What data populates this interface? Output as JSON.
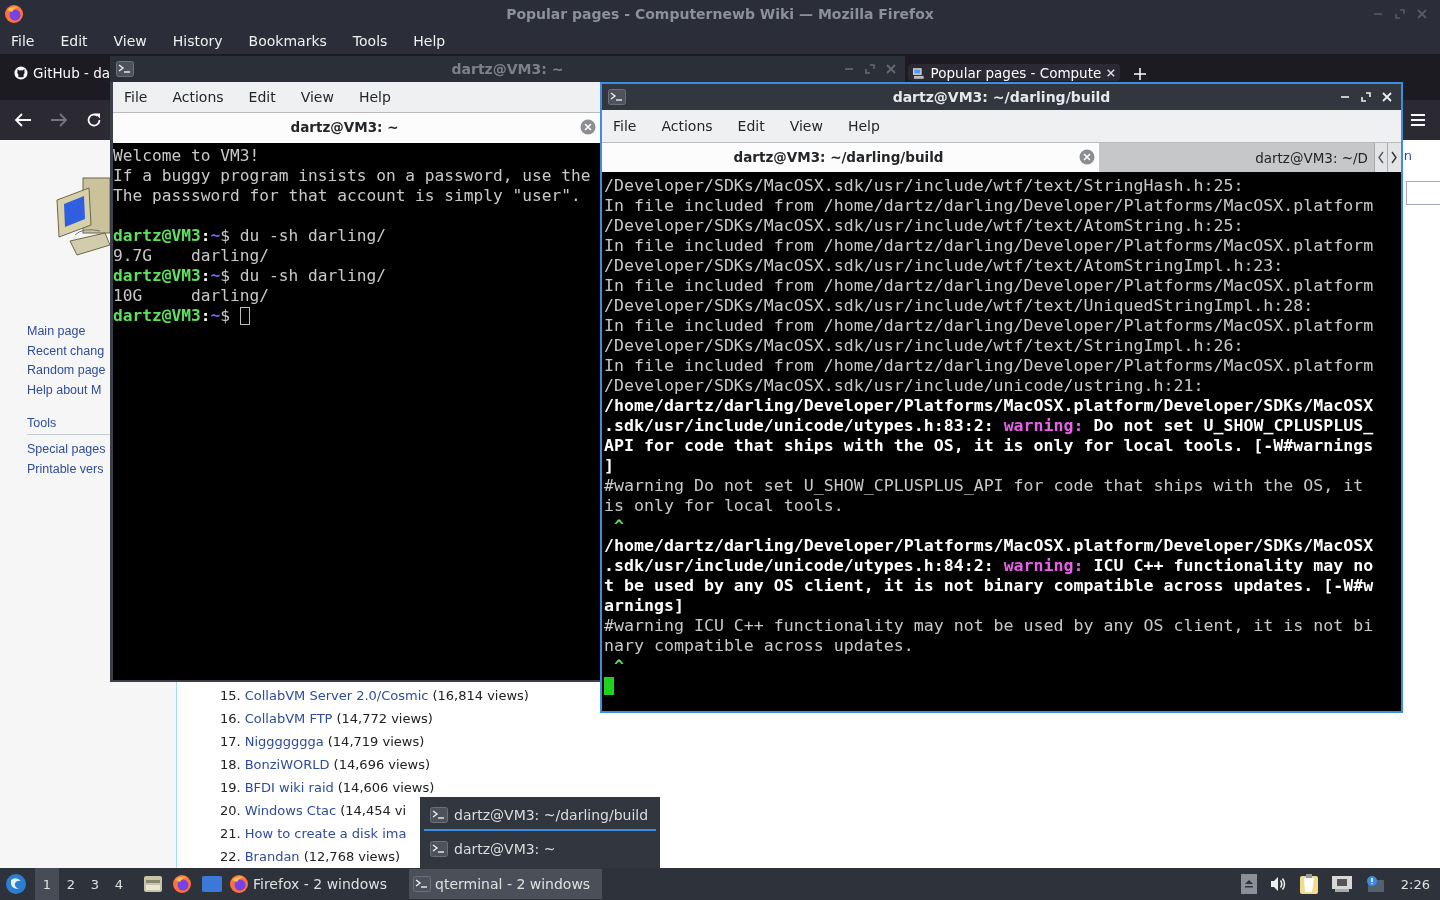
{
  "firefox": {
    "title": "Popular pages - Computernewb Wiki — Mozilla Firefox",
    "menu": [
      "File",
      "Edit",
      "View",
      "History",
      "Bookmarks",
      "Tools",
      "Help"
    ],
    "tabs": [
      {
        "label": "GitHub - da",
        "selected": false
      },
      {
        "label": "Popular pages - Compute",
        "selected": true
      }
    ],
    "forward_enabled": false,
    "wiki": {
      "sidebar_links": [
        "Main page",
        "Recent chang",
        "Random page",
        "Help about M"
      ],
      "tools_heading": "Tools",
      "tools_links": [
        "Special pages",
        "Printable vers"
      ],
      "top_link": "n",
      "list": [
        {
          "number": "15.",
          "title": "CollabVM Server 2.0/Cosmic",
          "views": "(16,814 views)"
        },
        {
          "number": "16.",
          "title": "CollabVM FTP",
          "views": "(14,772 views)"
        },
        {
          "number": "17.",
          "title": "Niggggggga",
          "views": "(14,719 views)"
        },
        {
          "number": "18.",
          "title": "BonziWORLD",
          "views": "(14,696 views)"
        },
        {
          "number": "19.",
          "title": "BFDI wiki raid",
          "views": "(14,606 views)"
        },
        {
          "number": "20.",
          "title": "Windows Ctac",
          "views": "(14,454 vi"
        },
        {
          "number": "21.",
          "title": "How to create a disk ima"
        },
        {
          "number": "22.",
          "title": "Brandan",
          "views": "(12,768 views)"
        }
      ]
    }
  },
  "terminals": [
    {
      "title": "dartz@VM3: ~",
      "focused": false,
      "menu": [
        "File",
        "Actions",
        "Edit",
        "View",
        "Help"
      ],
      "tabs": [
        {
          "label": "dartz@VM3: ~",
          "selected": true
        }
      ],
      "lines": [
        {
          "kind": "text",
          "segments": [
            {
              "kind": "plain",
              "text": "Welcome to VM3!"
            }
          ]
        },
        {
          "kind": "text",
          "segments": [
            {
              "kind": "plain",
              "text": "If a buggy program insists on a password, use the"
            }
          ]
        },
        {
          "kind": "text",
          "segments": [
            {
              "kind": "plain",
              "text": "The passsword for that account is simply \"user\"."
            }
          ]
        },
        {
          "kind": "blank"
        },
        {
          "kind": "text",
          "segments": [
            {
              "kind": "user",
              "text": "dartz@VM3"
            },
            {
              "kind": "bold",
              "text": ":"
            },
            {
              "kind": "path",
              "text": "~"
            },
            {
              "kind": "plain",
              "text": "$ du -sh darling/"
            }
          ]
        },
        {
          "kind": "text",
          "segments": [
            {
              "kind": "plain",
              "text": "9.7G    darling/"
            }
          ]
        },
        {
          "kind": "text",
          "segments": [
            {
              "kind": "user",
              "text": "dartz@VM3"
            },
            {
              "kind": "bold",
              "text": ":"
            },
            {
              "kind": "path",
              "text": "~"
            },
            {
              "kind": "plain",
              "text": "$ du -sh darling/"
            }
          ]
        },
        {
          "kind": "text",
          "segments": [
            {
              "kind": "plain",
              "text": "10G     darling/"
            }
          ]
        },
        {
          "kind": "text",
          "segments": [
            {
              "kind": "user",
              "text": "dartz@VM3"
            },
            {
              "kind": "bold",
              "text": ":"
            },
            {
              "kind": "path",
              "text": "~"
            },
            {
              "kind": "plain",
              "text": "$ "
            },
            {
              "kind": "cursor"
            }
          ]
        }
      ]
    },
    {
      "title": "dartz@VM3: ~/darling/build",
      "focused": true,
      "menu": [
        "File",
        "Actions",
        "Edit",
        "View",
        "Help"
      ],
      "tabs": [
        {
          "label": "dartz@VM3: ~/darling/build",
          "selected": true
        },
        {
          "label": "dartz@VM3: ~/D",
          "selected": false
        }
      ],
      "lines": [
        {
          "kind": "text",
          "segments": [
            {
              "kind": "plain",
              "text": "/Developer/SDKs/MacOSX.sdk/usr/include/wtf/text/StringHash.h:25:"
            }
          ]
        },
        {
          "kind": "text",
          "segments": [
            {
              "kind": "plain",
              "text": "In file included from /home/dartz/darling/Developer/Platforms/MacOSX.platform"
            }
          ]
        },
        {
          "kind": "text",
          "segments": [
            {
              "kind": "plain",
              "text": "/Developer/SDKs/MacOSX.sdk/usr/include/wtf/text/AtomString.h:25:"
            }
          ]
        },
        {
          "kind": "text",
          "segments": [
            {
              "kind": "plain",
              "text": "In file included from /home/dartz/darling/Developer/Platforms/MacOSX.platform"
            }
          ]
        },
        {
          "kind": "text",
          "segments": [
            {
              "kind": "plain",
              "text": "/Developer/SDKs/MacOSX.sdk/usr/include/wtf/text/AtomStringImpl.h:23:"
            }
          ]
        },
        {
          "kind": "text",
          "segments": [
            {
              "kind": "plain",
              "text": "In file included from /home/dartz/darling/Developer/Platforms/MacOSX.platform"
            }
          ]
        },
        {
          "kind": "text",
          "segments": [
            {
              "kind": "plain",
              "text": "/Developer/SDKs/MacOSX.sdk/usr/include/wtf/text/UniquedStringImpl.h:28:"
            }
          ]
        },
        {
          "kind": "text",
          "segments": [
            {
              "kind": "plain",
              "text": "In file included from /home/dartz/darling/Developer/Platforms/MacOSX.platform"
            }
          ]
        },
        {
          "kind": "text",
          "segments": [
            {
              "kind": "plain",
              "text": "/Developer/SDKs/MacOSX.sdk/usr/include/wtf/text/StringImpl.h:26:"
            }
          ]
        },
        {
          "kind": "text",
          "segments": [
            {
              "kind": "plain",
              "text": "In file included from /home/dartz/darling/Developer/Platforms/MacOSX.platform"
            }
          ]
        },
        {
          "kind": "text",
          "segments": [
            {
              "kind": "plain",
              "text": "/Developer/SDKs/MacOSX.sdk/usr/include/unicode/ustring.h:21:"
            }
          ]
        },
        {
          "kind": "text",
          "segments": [
            {
              "kind": "bold",
              "text": "/home/dartz/darling/Developer/Platforms/MacOSX.platform/Developer/SDKs/MacOSX"
            }
          ]
        },
        {
          "kind": "text",
          "segments": [
            {
              "kind": "bold",
              "text": ".sdk/usr/include/unicode/utypes.h:83:2: "
            },
            {
              "kind": "warning",
              "text": "warning:"
            },
            {
              "kind": "bold",
              "text": " Do not set U_SHOW_CPLUSPLUS_"
            }
          ]
        },
        {
          "kind": "text",
          "segments": [
            {
              "kind": "bold",
              "text": "API for code that ships with the OS, it is only for local tools. [-W#warnings"
            }
          ]
        },
        {
          "kind": "text",
          "segments": [
            {
              "kind": "bold",
              "text": "]"
            }
          ]
        },
        {
          "kind": "text",
          "segments": [
            {
              "kind": "plain",
              "text": "#warning Do not set U_SHOW_CPLUSPLUS_API for code that ships with the OS, it"
            }
          ]
        },
        {
          "kind": "text",
          "segments": [
            {
              "kind": "plain",
              "text": "is only for local tools."
            }
          ]
        },
        {
          "kind": "text",
          "segments": [
            {
              "kind": "caret",
              "text": " ^"
            }
          ]
        },
        {
          "kind": "text",
          "segments": [
            {
              "kind": "bold",
              "text": "/home/dartz/darling/Developer/Platforms/MacOSX.platform/Developer/SDKs/MacOSX"
            }
          ]
        },
        {
          "kind": "text",
          "segments": [
            {
              "kind": "bold",
              "text": ".sdk/usr/include/unicode/utypes.h:84:2: "
            },
            {
              "kind": "warning",
              "text": "warning:"
            },
            {
              "kind": "bold",
              "text": " ICU C++ functionality may no"
            }
          ]
        },
        {
          "kind": "text",
          "segments": [
            {
              "kind": "bold",
              "text": "t be used by any OS client, it is not binary compatible across updates. [-W#w"
            }
          ]
        },
        {
          "kind": "text",
          "segments": [
            {
              "kind": "bold",
              "text": "arnings]"
            }
          ]
        },
        {
          "kind": "text",
          "segments": [
            {
              "kind": "plain",
              "text": "#warning ICU C++ functionality may not be used by any OS client, it is not bi"
            }
          ]
        },
        {
          "kind": "text",
          "segments": [
            {
              "kind": "plain",
              "text": "nary compatible across updates."
            }
          ]
        },
        {
          "kind": "text",
          "segments": [
            {
              "kind": "caret",
              "text": " ^"
            }
          ]
        },
        {
          "kind": "text",
          "segments": [
            {
              "kind": "cursor"
            }
          ]
        }
      ]
    }
  ],
  "window_list_popup": {
    "items": [
      {
        "label": "dartz@VM3: ~/darling/build",
        "selected": true
      },
      {
        "label": "dartz@VM3: ~",
        "selected": false
      }
    ]
  },
  "taskbar": {
    "desktops": [
      {
        "label": "1",
        "selected": true
      },
      {
        "label": "2",
        "selected": false
      },
      {
        "label": "3",
        "selected": false
      },
      {
        "label": "4",
        "selected": false
      }
    ],
    "tasks": [
      {
        "label": "Firefox - 2 windows",
        "kind": "firefox",
        "selected": false
      },
      {
        "label": "qterminal - 2 windows",
        "kind": "terminal",
        "selected": true
      }
    ],
    "clock": "2:26"
  }
}
